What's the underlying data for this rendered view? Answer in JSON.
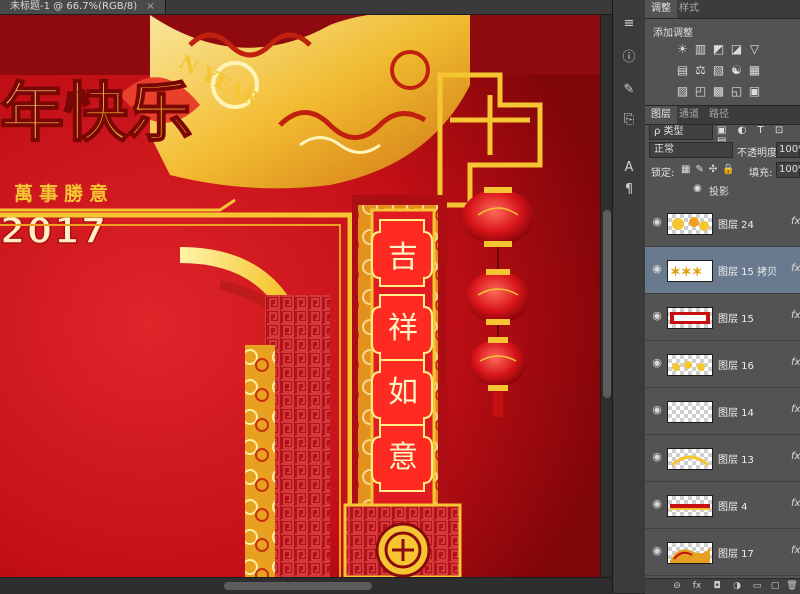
{
  "document": {
    "tab_title": "未标题-1 @ 66.7%(RGB/8)",
    "close_glyph": "×"
  },
  "artwork": {
    "title_chars": "年快乐",
    "subtitle": "萬事勝意",
    "year_text": "2017",
    "new_year_text": "N YEAR",
    "banner_chars": [
      "吉",
      "祥",
      "如",
      "意"
    ],
    "colors": {
      "bg": "#c10f15",
      "gold": "#f5c532",
      "deep_red": "#8a0a0c"
    }
  },
  "toolstrip": {
    "tools": [
      {
        "name": "history-tool-icon",
        "glyph": "≡"
      },
      {
        "name": "info-tool-icon",
        "glyph": "ⓘ"
      },
      {
        "name": "brush-preset-tool-icon",
        "glyph": "✎"
      },
      {
        "name": "clone-source-tool-icon",
        "glyph": "⎘"
      },
      {
        "name": "character-tool-icon",
        "glyph": "A"
      },
      {
        "name": "paragraph-tool-icon",
        "glyph": "¶"
      }
    ]
  },
  "panels": {
    "adjust_tab": "调整",
    "style_tab": "样式",
    "add_adjustment": "添加调整",
    "adjustment_icons": [
      [
        "☀",
        "▥",
        "◩",
        "◪",
        "▽"
      ],
      [
        "▤",
        "⚖",
        "▧",
        "☯",
        "▦"
      ],
      [
        "▨",
        "◰",
        "▩",
        "◱",
        "▣"
      ]
    ],
    "layers_tab": "图层",
    "channels_tab": "通道",
    "paths_tab": "路径",
    "filter_kind": "ρ 类型",
    "blend_mode": "正常",
    "opacity_label": "不透明度:",
    "opacity_value": "100%",
    "lock_label": "锁定:",
    "fill_label": "填充:",
    "fill_value": "100%",
    "effect_label": "投影",
    "layers": [
      {
        "name": "图层 24",
        "selected": false,
        "fx": "fx"
      },
      {
        "name": "图层 15 拷贝",
        "selected": true,
        "fx": "fx"
      },
      {
        "name": "图层 15",
        "selected": false,
        "fx": "fx"
      },
      {
        "name": "图层 16",
        "selected": false,
        "fx": "fx"
      },
      {
        "name": "图层 14",
        "selected": false,
        "fx": "fx"
      },
      {
        "name": "图层 13",
        "selected": false,
        "fx": "fx"
      },
      {
        "name": "图层 4",
        "selected": false,
        "fx": "fx"
      },
      {
        "name": "图层 17",
        "selected": false,
        "fx": "fx"
      }
    ],
    "bottom_icons": [
      "⊝",
      "fx",
      "◘",
      "◑",
      "▭",
      "▢",
      "🗑"
    ]
  }
}
